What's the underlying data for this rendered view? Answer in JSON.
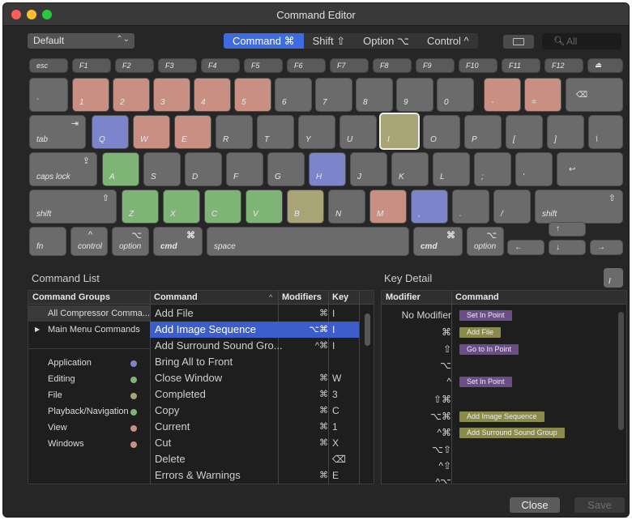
{
  "window": {
    "title": "Command Editor"
  },
  "colors": {
    "accent": "#3d6ce0",
    "red": "#c98f83",
    "blue": "#7c84cc",
    "green": "#7fb477",
    "olive": "#a8a476"
  },
  "toolbar": {
    "preset": "Default",
    "modifiers": [
      "Command ⌘",
      "Shift ⇧",
      "Option ⌥",
      "Control ^"
    ],
    "search_placeholder": "All"
  },
  "keyboard": {
    "fn_row": [
      "esc",
      "F1",
      "F2",
      "F3",
      "F4",
      "F5",
      "F6",
      "F7",
      "F8",
      "F9",
      "F10",
      "F11",
      "F12",
      "⏏"
    ],
    "row1": [
      "`",
      "1",
      "2",
      "3",
      "4",
      "5",
      "6",
      "7",
      "8",
      "9",
      "0",
      "-",
      "=",
      "⌫"
    ],
    "row2": [
      "tab",
      "Q",
      "W",
      "E",
      "R",
      "T",
      "Y",
      "U",
      "I",
      "O",
      "P",
      "[",
      "]",
      "\\"
    ],
    "row3": [
      "caps lock",
      "A",
      "S",
      "D",
      "F",
      "G",
      "H",
      "J",
      "K",
      "L",
      ";",
      "'",
      "↩"
    ],
    "row4": [
      "shift",
      "Z",
      "X",
      "C",
      "V",
      "B",
      "N",
      "M",
      ",",
      ".",
      "/",
      "shift"
    ],
    "row5": [
      "fn",
      "control",
      "option",
      "cmd",
      "space",
      "cmd",
      "option",
      "←",
      "↑",
      "↓",
      "→"
    ],
    "symbols": {
      "tab": "⇥",
      "caps": "⇪",
      "shift": "⇧",
      "control": "^",
      "option": "⌥",
      "cmd": "⌘"
    }
  },
  "command_list": {
    "title": "Command List",
    "groups_header": "Command Groups",
    "command_header": "Command",
    "modifiers_header": "Modifiers",
    "key_header": "Key",
    "groups": [
      "All Compressor Comma...",
      "Main Menu Commands"
    ],
    "categories": [
      {
        "name": "Application",
        "color": "#7c84cc"
      },
      {
        "name": "Editing",
        "color": "#7fb477"
      },
      {
        "name": "File",
        "color": "#a8a476"
      },
      {
        "name": "Playback/Navigation",
        "color": "#7fb477"
      },
      {
        "name": "View",
        "color": "#c98f83"
      },
      {
        "name": "Windows",
        "color": "#c98f83"
      }
    ],
    "rows": [
      {
        "command": "Add File",
        "modifiers": "⌘",
        "key": "I"
      },
      {
        "command": "Add Image Sequence",
        "modifiers": "⌥⌘",
        "key": "I"
      },
      {
        "command": "Add Surround Sound Gro...",
        "modifiers": "^⌘",
        "key": "I"
      },
      {
        "command": "Bring All to Front",
        "modifiers": "",
        "key": ""
      },
      {
        "command": "Close Window",
        "modifiers": "⌘",
        "key": "W"
      },
      {
        "command": "Completed",
        "modifiers": "⌘",
        "key": "3"
      },
      {
        "command": "Copy",
        "modifiers": "⌘",
        "key": "C"
      },
      {
        "command": "Current",
        "modifiers": "⌘",
        "key": "1"
      },
      {
        "command": "Cut",
        "modifiers": "⌘",
        "key": "X"
      },
      {
        "command": "Delete",
        "modifiers": "",
        "key": "⌫"
      },
      {
        "command": "Errors & Warnings",
        "modifiers": "⌘",
        "key": "E"
      }
    ]
  },
  "key_detail": {
    "title": "Key Detail",
    "key_badge": "I",
    "modifier_header": "Modifier",
    "command_header": "Command",
    "rows": [
      {
        "modifier": "No Modifier",
        "command": "Set In Point",
        "color": "#6a4f86"
      },
      {
        "modifier": "⌘",
        "command": "Add File",
        "color": "#8a8a4a"
      },
      {
        "modifier": "⇧",
        "command": "Go to In Point",
        "color": "#6a4f86"
      },
      {
        "modifier": "⌥",
        "command": "",
        "color": ""
      },
      {
        "modifier": "^",
        "command": "Set In Point",
        "color": "#6a4f86"
      },
      {
        "modifier": "⇧⌘",
        "command": "",
        "color": ""
      },
      {
        "modifier": "⌥⌘",
        "command": "Add Image Sequence",
        "color": "#8a8a4a"
      },
      {
        "modifier": "^⌘",
        "command": "Add Surround Sound Group",
        "color": "#8a8a4a"
      },
      {
        "modifier": "⌥⇧",
        "command": "",
        "color": ""
      },
      {
        "modifier": "^⇧",
        "command": "",
        "color": ""
      },
      {
        "modifier": "^⌥",
        "command": "",
        "color": ""
      }
    ]
  },
  "footer": {
    "close": "Close",
    "save": "Save"
  }
}
